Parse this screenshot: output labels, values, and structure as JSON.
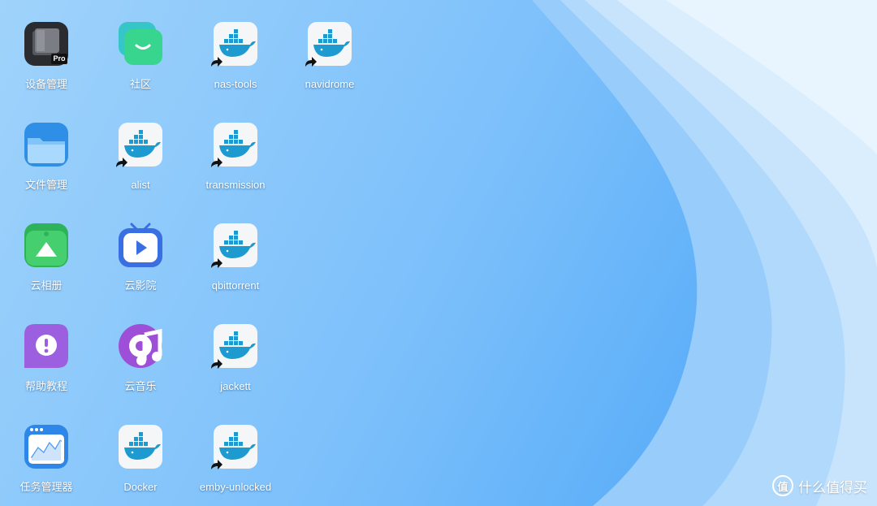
{
  "desktop": {
    "apps": [
      {
        "id": "device-manager",
        "label": "设备管理",
        "icon": "device-manager-icon"
      },
      {
        "id": "community",
        "label": "社区",
        "icon": "community-icon"
      },
      {
        "id": "nas-tools",
        "label": "nas-tools",
        "icon": "docker-icon",
        "shortcut": true
      },
      {
        "id": "navidrome",
        "label": "navidrome",
        "icon": "docker-icon",
        "shortcut": true
      },
      {
        "id": "file-manager",
        "label": "文件管理",
        "icon": "folder-icon"
      },
      {
        "id": "alist",
        "label": "alist",
        "icon": "docker-icon",
        "shortcut": true
      },
      {
        "id": "transmission",
        "label": "transmission",
        "icon": "docker-icon",
        "shortcut": true
      },
      {
        "id": "cloud-album",
        "label": "云相册",
        "icon": "photo-album-icon"
      },
      {
        "id": "cloud-cinema",
        "label": "云影院",
        "icon": "tv-play-icon"
      },
      {
        "id": "qbittorrent",
        "label": "qbittorrent",
        "icon": "docker-icon",
        "shortcut": true
      },
      {
        "id": "help",
        "label": "帮助教程",
        "icon": "help-icon"
      },
      {
        "id": "cloud-music",
        "label": "云音乐",
        "icon": "music-icon"
      },
      {
        "id": "jackett",
        "label": "jackett",
        "icon": "docker-icon",
        "shortcut": true
      },
      {
        "id": "task-manager",
        "label": "任务管理器",
        "icon": "task-manager-icon"
      },
      {
        "id": "docker",
        "label": "Docker",
        "icon": "docker-icon",
        "shortcut": false
      },
      {
        "id": "emby-unlocked",
        "label": "emby-unlocked",
        "icon": "docker-icon",
        "shortcut": true
      }
    ],
    "device_manager_badge": "Pro"
  },
  "watermark": {
    "logo_text": "值",
    "text": "什么值得买"
  },
  "colors": {
    "accent": "#2f8fe6",
    "docker": "#1d9bd1",
    "wallpaper": "#8cc8fb"
  }
}
